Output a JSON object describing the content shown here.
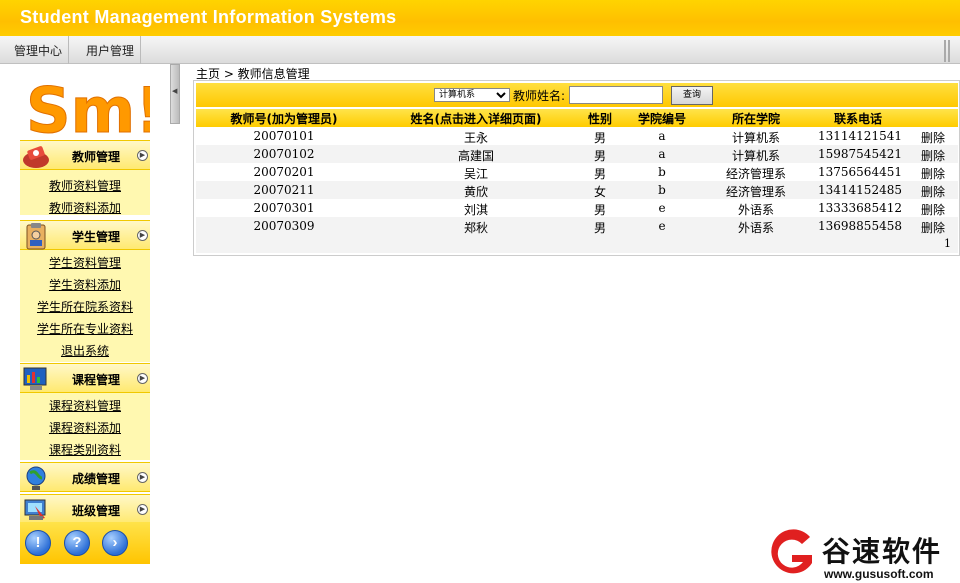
{
  "banner": {
    "title": "Student Management Information Systems"
  },
  "menubar": {
    "items": [
      "管理中心",
      "用户管理"
    ]
  },
  "logo": {
    "text": "Sm!"
  },
  "sidebar": {
    "sections": [
      {
        "label": "教师管理",
        "icon": "teacher-icon",
        "links": [
          "教师资料管理",
          "教师资料添加"
        ]
      },
      {
        "label": "学生管理",
        "icon": "clipboard-icon",
        "links": [
          "学生资料管理",
          "学生资料添加",
          "学生所在院系资料",
          "学生所在专业资料",
          "退出系统"
        ]
      },
      {
        "label": "课程管理",
        "icon": "monitor-icon",
        "links": [
          "课程资料管理",
          "课程资料添加",
          "课程类别资料"
        ]
      },
      {
        "label": "成绩管理",
        "icon": "globe-icon",
        "links": []
      },
      {
        "label": "班级管理",
        "icon": "computer-icon",
        "links": []
      }
    ],
    "help_buttons": [
      "!",
      "?",
      "›"
    ]
  },
  "breadcrumb": "主页 > 教师信息管理",
  "search": {
    "college_selected": "计算机系",
    "name_label": "教师姓名:",
    "name_value": "",
    "button": "查询"
  },
  "table": {
    "headers": [
      "教师号(加为管理员)",
      "姓名(点击进入详细页面)",
      "性别",
      "学院编号",
      "所在学院",
      "联系电话",
      ""
    ],
    "rows": [
      [
        "20070101",
        "王永",
        "男",
        "a",
        "计算机系",
        "13114121541",
        "删除"
      ],
      [
        "20070102",
        "高建国",
        "男",
        "a",
        "计算机系",
        "15987545421",
        "删除"
      ],
      [
        "20070201",
        "吴江",
        "男",
        "b",
        "经济管理系",
        "13756564451",
        "删除"
      ],
      [
        "20070211",
        "黄欣",
        "女",
        "b",
        "经济管理系",
        "13414152485",
        "删除"
      ],
      [
        "20070301",
        "刘淇",
        "男",
        "e",
        "外语系",
        "13333685412",
        "删除"
      ],
      [
        "20070309",
        "郑秋",
        "男",
        "e",
        "外语系",
        "13698855458",
        "删除"
      ]
    ],
    "page": "1"
  },
  "watermark": {
    "text": "谷速软件",
    "url": "www.gususoft.com"
  },
  "colors": {
    "accent": "#ffcc00",
    "sidebar_bg": "#fff8b0",
    "logo": "#ff9900"
  }
}
